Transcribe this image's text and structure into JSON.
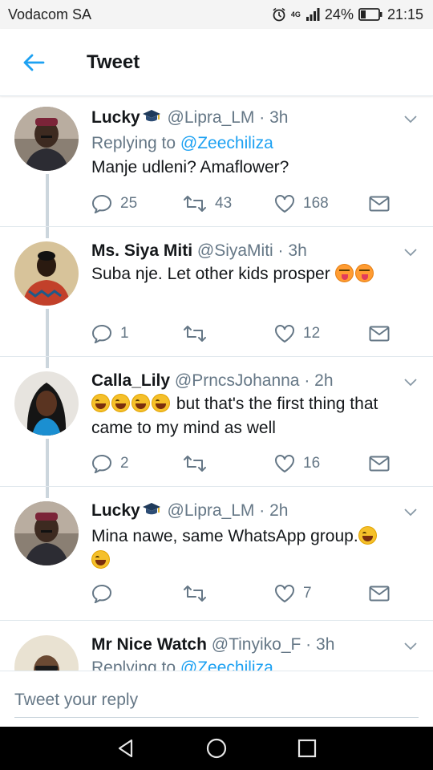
{
  "status_bar": {
    "carrier": "Vodacom SA",
    "network": "4G",
    "battery": "24%",
    "time": "21:15"
  },
  "app_bar": {
    "title": "Tweet"
  },
  "colors": {
    "accent": "#1da1f2",
    "muted": "#657786",
    "text": "#14171a"
  },
  "tweets": [
    {
      "name": "Lucky",
      "handle": "@Lipra_LM",
      "dot": "·",
      "time": "3h",
      "replying_label": "Replying to",
      "replying_to": "@Zeechiliza",
      "text": "Manje udleni? Amaflower?",
      "replies": "25",
      "retweets": "43",
      "likes": "168"
    },
    {
      "name": "Ms. Siya Miti",
      "handle": "@SiyaMiti",
      "dot": "·",
      "time": "3h",
      "text": "Suba nje. Let other kids prosper",
      "replies": "1",
      "retweets": "",
      "likes": "12"
    },
    {
      "name": "Calla_Lily",
      "handle": "@PrncsJohanna",
      "dot": "·",
      "time": "2h",
      "text_line1": "but that's the first thing that",
      "text_line2": "came to my mind as well",
      "replies": "2",
      "retweets": "",
      "likes": "16"
    },
    {
      "name": "Lucky",
      "handle": "@Lipra_LM",
      "dot": "·",
      "time": "2h",
      "text": "Mina nawe, same WhatsApp group.",
      "replies": "",
      "retweets": "",
      "likes": "7"
    },
    {
      "name": "Mr Nice Watch",
      "handle": "@Tinyiko_F",
      "dot": "·",
      "time": "3h",
      "replying_label": "Replying to",
      "replying_to": "@Zeechiliza"
    }
  ],
  "reply_bar": {
    "placeholder": "Tweet your reply"
  },
  "icons": [
    "back-arrow-icon",
    "alarm-icon",
    "signal-icon",
    "battery-icon",
    "chevron-down-icon",
    "reply-icon",
    "retweet-icon",
    "like-icon",
    "direct-message-icon",
    "graduation-cap-icon",
    "laughing-emoji-icon",
    "tongue-emoji-icon",
    "nav-back-icon",
    "nav-home-icon",
    "nav-recents-icon"
  ]
}
